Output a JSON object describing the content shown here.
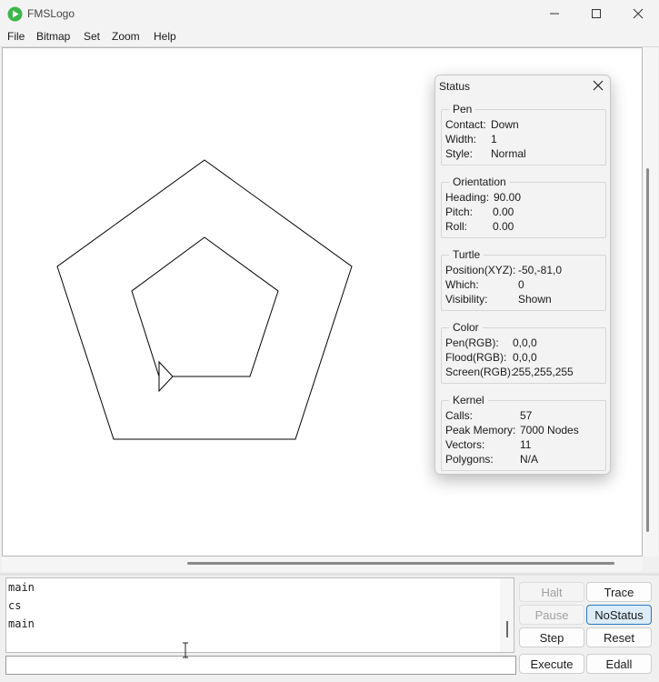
{
  "window": {
    "title": "FMSLogo",
    "controls": {
      "minimize": "minimize-icon",
      "maximize": "maximize-icon",
      "close": "close-icon"
    }
  },
  "menu": [
    "File",
    "Bitmap",
    "Set",
    "Zoom",
    "Help"
  ],
  "status_window": {
    "title": "Status",
    "groups": [
      {
        "title": "Pen",
        "rows": [
          {
            "label": "Contact:",
            "value": "Down"
          },
          {
            "label": "Width:",
            "value": "1"
          },
          {
            "label": "Style:",
            "value": "Normal"
          }
        ]
      },
      {
        "title": "Orientation",
        "rows": [
          {
            "label": "Heading:",
            "value": "90.00"
          },
          {
            "label": "Pitch:",
            "value": "0.00"
          },
          {
            "label": "Roll:",
            "value": "0.00"
          }
        ]
      },
      {
        "title": "Turtle",
        "rows": [
          {
            "label": "Position(XYZ):",
            "value": "-50,-81,0"
          },
          {
            "label": "Which:",
            "value": "0"
          },
          {
            "label": "Visibility:",
            "value": "Shown"
          }
        ]
      },
      {
        "title": "Color",
        "rows": [
          {
            "label": "Pen(RGB):",
            "value": "0,0,0"
          },
          {
            "label": "Flood(RGB):",
            "value": "0,0,0"
          },
          {
            "label": "Screen(RGB):",
            "value": "255,255,255"
          }
        ]
      },
      {
        "title": "Kernel",
        "rows": [
          {
            "label": "Calls:",
            "value": "57"
          },
          {
            "label": "Peak Memory:",
            "value": "7000 Nodes"
          },
          {
            "label": "Vectors:",
            "value": "11"
          },
          {
            "label": "Polygons:",
            "value": "N/A"
          }
        ]
      }
    ]
  },
  "history": [
    "main",
    "cs",
    "main"
  ],
  "input": {
    "value": ""
  },
  "buttons": {
    "halt": "Halt",
    "trace": "Trace",
    "pause": "Pause",
    "nostatus": "NoStatus",
    "step": "Step",
    "reset": "Reset",
    "execute": "Execute",
    "edall": "Edall"
  },
  "colors": {
    "accent": "#2a78c2",
    "app_icon": "#3db54a",
    "canvas_bg": "#ffffff",
    "pen": "#000000"
  }
}
